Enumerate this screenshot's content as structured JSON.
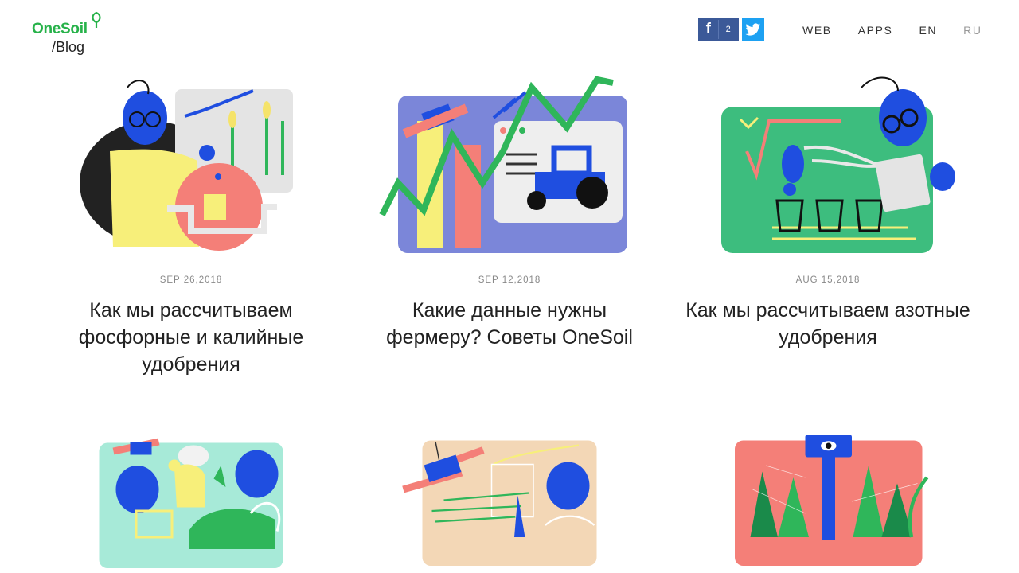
{
  "logo": {
    "name": "OneSoil",
    "section": "/Blog"
  },
  "social": {
    "facebook_count": "2"
  },
  "nav": {
    "web": "WEB",
    "apps": "APPS",
    "en": "EN",
    "ru": "RU"
  },
  "colors": {
    "brand_green": "#27b24a",
    "facebook": "#3b5998",
    "twitter": "#1da1f2",
    "illustration_blue": "#1f4ee0"
  },
  "posts": [
    {
      "date": "SEP 26,2018",
      "title": "Как мы рассчитываем фосфорные и калийные удобрения"
    },
    {
      "date": "SEP 12,2018",
      "title": "Какие данные нужны фермеру? Советы OneSoil"
    },
    {
      "date": "AUG 15,2018",
      "title": "Как мы рассчитываем азотные удобрения"
    },
    {
      "date": "",
      "title": ""
    },
    {
      "date": "",
      "title": ""
    },
    {
      "date": "",
      "title": ""
    }
  ]
}
